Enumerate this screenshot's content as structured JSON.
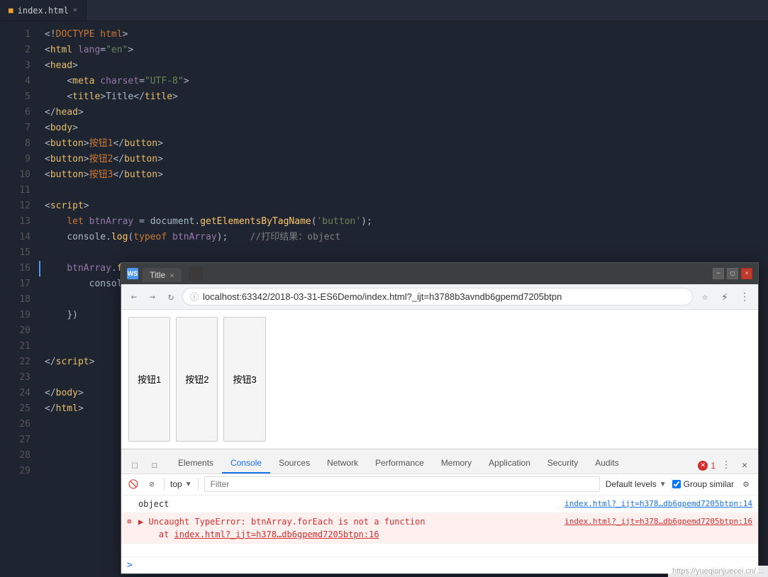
{
  "editor": {
    "tab": {
      "name": "index.html",
      "icon": "html-file-icon"
    },
    "lines": [
      {
        "num": 1,
        "html": "<span class='punct'>&lt;!</span><span class='kw'>DOCTYPE html</span><span class='punct'>&gt;</span>"
      },
      {
        "num": 2,
        "html": "<span class='punct'>&lt;</span><span class='tag'>html</span> <span class='attr'>lang</span><span class='punct'>=</span><span class='str'>\"en\"</span><span class='punct'>&gt;</span>"
      },
      {
        "num": 3,
        "html": "<span class='punct'>&lt;</span><span class='tag'>head</span><span class='punct'>&gt;</span>"
      },
      {
        "num": 4,
        "html": "    <span class='punct'>&lt;</span><span class='tag'>meta</span> <span class='attr'>charset</span><span class='punct'>=</span><span class='str'>\"UTF-8\"</span><span class='punct'>&gt;</span>"
      },
      {
        "num": 5,
        "html": "    <span class='punct'>&lt;</span><span class='tag'>title</span><span class='punct'>&gt;</span><span class='plain'>Title</span><span class='punct'>&lt;/</span><span class='tag'>title</span><span class='punct'>&gt;</span>"
      },
      {
        "num": 6,
        "html": "<span class='punct'>&lt;/</span><span class='tag'>head</span><span class='punct'>&gt;</span>"
      },
      {
        "num": 7,
        "html": "<span class='punct'>&lt;</span><span class='tag'>body</span><span class='punct'>&gt;</span>"
      },
      {
        "num": 8,
        "html": "<span class='punct'>&lt;</span><span class='tag'>button</span><span class='punct'>&gt;</span><span class='plain'>按钮1</span><span class='punct'>&lt;/</span><span class='tag'>button</span><span class='punct'>&gt;</span>"
      },
      {
        "num": 9,
        "html": "<span class='punct'>&lt;</span><span class='tag'>button</span><span class='punct'>&gt;</span><span class='plain'>按钮2</span><span class='punct'>&lt;/</span><span class='tag'>button</span><span class='punct'>&gt;</span>"
      },
      {
        "num": 10,
        "html": "<span class='punct'>&lt;</span><span class='tag'>button</span><span class='punct'>&gt;</span><span class='plain'>按钮3</span><span class='punct'>&lt;/</span><span class='tag'>button</span><span class='punct'>&gt;</span>"
      },
      {
        "num": 11,
        "html": ""
      },
      {
        "num": 12,
        "html": "<span class='punct'>&lt;</span><span class='tag'>script</span><span class='punct'>&gt;</span>"
      },
      {
        "num": 13,
        "html": "    <span class='kw'>let</span> <span class='var'>btnArray</span> <span class='punct'>=</span> <span class='plain'>document</span><span class='punct'>.</span><span class='method'>getElementsByTagName</span><span class='punct'>(</span><span class='str'>'button'</span><span class='punct'>);</span>"
      },
      {
        "num": 14,
        "html": "    <span class='plain'>console</span><span class='punct'>.</span><span class='method'>log</span><span class='punct'>(</span><span class='kw'>typeof</span> <span class='var'>btnArray</span><span class='punct'>);</span>    <span class='comment'>//打印结果：object</span>"
      },
      {
        "num": 15,
        "html": ""
      },
      {
        "num": 16,
        "html": "    <span class='var'>btnArray</span><span class='punct'>.</span><span class='method'>forEach</span><span class='punct'>(</span><span class='kw'>function</span> <span class='punct'>(</span><span class='plain'>item</span><span class='punct'>,</span> <span class='plain'>index</span><span class='punct'>)</span> <span class='punct'>{</span>",
        "active": true
      },
      {
        "num": 17,
        "html": "        <span class='plain'>console</span><span class='punct'>.</span><span class='method'>log</span><span class='punct'>(</span><span class='plain'>item</span><span class='punct'>);</span>"
      },
      {
        "num": 18,
        "html": ""
      },
      {
        "num": 19,
        "html": "    <span class='punct'>})</span>"
      },
      {
        "num": 20,
        "html": ""
      },
      {
        "num": 21,
        "html": ""
      },
      {
        "num": 22,
        "html": "<span class='punct'>&lt;/</span><span class='tag'>script</span><span class='punct'>&gt;</span>"
      },
      {
        "num": 23,
        "html": ""
      },
      {
        "num": 24,
        "html": "<span class='punct'>&lt;/</span><span class='tag'>body</span><span class='punct'>&gt;</span>"
      },
      {
        "num": 25,
        "html": "<span class='punct'>&lt;/</span><span class='tag'>html</span><span class='punct'>&gt;</span>"
      },
      {
        "num": 26,
        "html": ""
      },
      {
        "num": 27,
        "html": ""
      },
      {
        "num": 28,
        "html": ""
      },
      {
        "num": 29,
        "html": ""
      }
    ]
  },
  "browser": {
    "titlebar": {
      "icon_label": "WS",
      "title": "Title",
      "tab_title": "Title",
      "close_label": "×",
      "minimize_label": "−",
      "restore_label": "□"
    },
    "toolbar": {
      "back_label": "←",
      "forward_label": "→",
      "refresh_label": "↻",
      "url": "localhost:63342/2018-03-31-ES6Demo/index.html?_ijt=h3788b3avndb6gpemd7205btpn",
      "bookmark_label": "☆",
      "more_label": "⋮"
    },
    "page": {
      "btn1": "按钮1",
      "btn2": "按钮2",
      "btn3": "按钮3"
    },
    "devtools": {
      "tabs": [
        "Elements",
        "Console",
        "Sources",
        "Network",
        "Performance",
        "Memory",
        "Application",
        "Security",
        "Audits"
      ],
      "active_tab": "Console",
      "error_count": "1",
      "toolbar": {
        "top_selector": "top",
        "filter_placeholder": "Filter",
        "level_selector": "Default levels",
        "group_similar_label": "Group similar"
      },
      "console_output": [
        {
          "type": "normal",
          "text": "object",
          "link": "index.html?_ijt=h378…db6gpemd7205btpn:14"
        },
        {
          "type": "error",
          "icon": "●",
          "prefix": "▶",
          "text": "Uncaught TypeError: btnArray.forEach is not a function",
          "sub_text": "at index.html?_ijt=h378…db6gpemd7205btpn:16",
          "link": "index.html?_ijt=h378…db6gpemd7205btpn:16"
        }
      ],
      "input_prompt": ">"
    }
  },
  "watermark": {
    "text": "https://yueqianjuecei.cn/…"
  }
}
